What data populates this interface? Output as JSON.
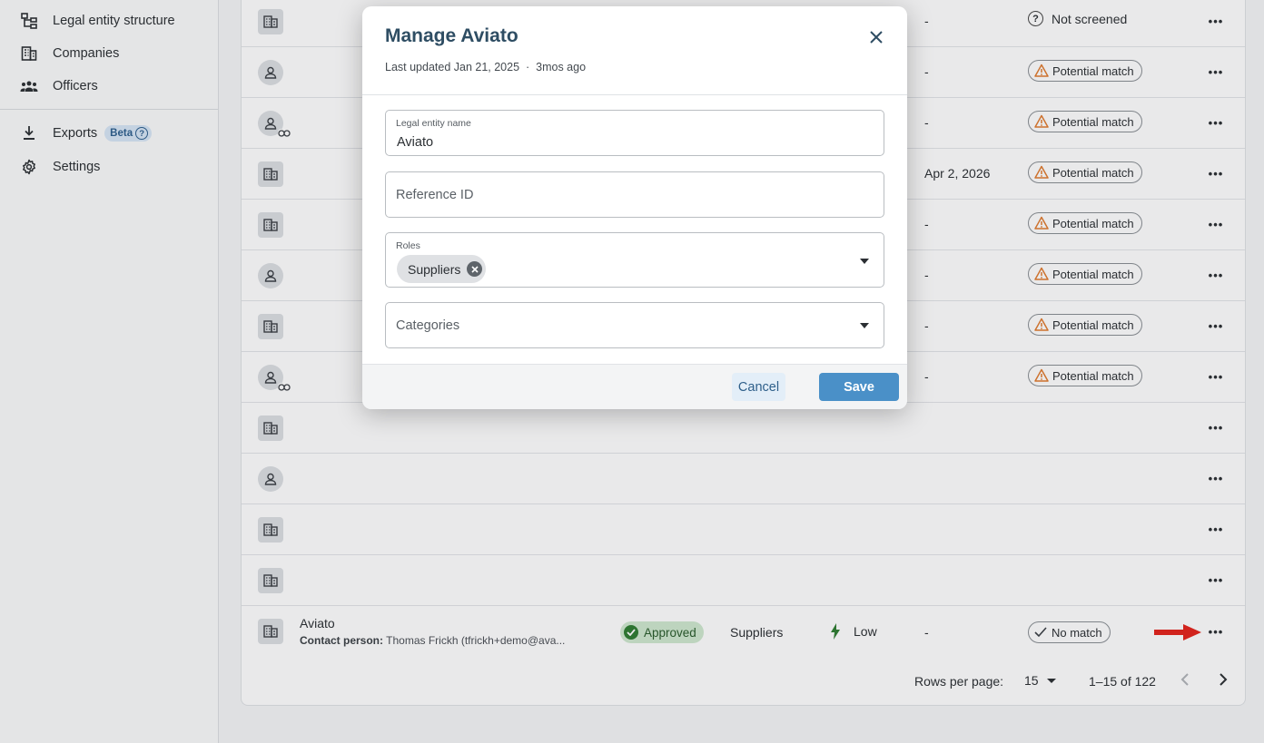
{
  "sidebar": {
    "items": [
      {
        "label": "Legal entity structure",
        "icon": "hierarchy-icon"
      },
      {
        "label": "Companies",
        "icon": "building-icon"
      },
      {
        "label": "Officers",
        "icon": "people-icon"
      },
      {
        "label": "Exports",
        "icon": "download-icon",
        "badge": "Beta"
      },
      {
        "label": "Settings",
        "icon": "gear-icon"
      }
    ]
  },
  "table": {
    "rows": [
      {
        "avatar": "building",
        "timestamp": "-",
        "screening": "Not screened"
      },
      {
        "avatar": "person",
        "timestamp": "-",
        "screening": "Potential match"
      },
      {
        "avatar": "person-link",
        "timestamp": "-",
        "screening": "Potential match"
      },
      {
        "avatar": "building",
        "timestamp": "Apr 2, 2026",
        "screening": "Potential match"
      },
      {
        "avatar": "building",
        "timestamp": "-",
        "screening": "Potential match"
      },
      {
        "avatar": "person",
        "timestamp": "-",
        "screening": "Potential match"
      },
      {
        "avatar": "building",
        "timestamp": "-",
        "screening": "Potential match"
      },
      {
        "avatar": "person-link",
        "timestamp": "-",
        "screening": "Potential match"
      },
      {
        "avatar": "building",
        "timestamp": "",
        "screening": ""
      },
      {
        "avatar": "person",
        "timestamp": "",
        "screening": ""
      },
      {
        "avatar": "building",
        "timestamp": "",
        "screening": ""
      },
      {
        "avatar": "building",
        "timestamp": "",
        "screening": ""
      }
    ],
    "last_row": {
      "name": "Aviato",
      "contact_label": "Contact person:",
      "contact_value": "Thomas Frickh (tfrickh+demo@ava...",
      "status": "Approved",
      "role": "Suppliers",
      "risk": "Low",
      "date": "-",
      "screening": "No match"
    },
    "more_glyph": "•••",
    "pager": {
      "rows_label": "Rows per page:",
      "rows_value": "15",
      "range": "1–15 of 122",
      "prev": "‹",
      "next": "›"
    }
  },
  "colors": {
    "accent": "#4a90c8",
    "title": "#2e4d63",
    "warning": "#e07b2e",
    "approved_bg": "#cfe8cf",
    "arrow": "#e5231b"
  },
  "modal": {
    "title": "Manage Aviato",
    "updated": "Last updated Jan 21, 2025",
    "separator": "·",
    "ago": "3mos ago",
    "fields": {
      "legal_name_label": "Legal entity name",
      "legal_name_value": "Aviato",
      "reference_placeholder": "Reference ID",
      "roles_label": "Roles",
      "roles_chip": "Suppliers",
      "categories_placeholder": "Categories"
    },
    "cancel_label": "Cancel",
    "save_label": "Save"
  }
}
